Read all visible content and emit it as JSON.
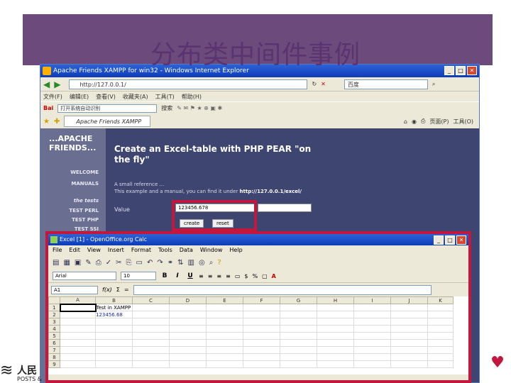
{
  "slide": {
    "title": "分布类中间件事例",
    "accent_color": "#6d4a7c",
    "highlight_color": "#c2183e"
  },
  "browser": {
    "window_title": "Apache Friends XAMPP for win32 - Windows Internet Explorer",
    "address": "http://127.0.0.1/",
    "search_text": "百度",
    "menu": [
      "文件(F)",
      "编辑(E)",
      "查看(V)",
      "收藏夹(A)",
      "工具(T)",
      "帮助(H)"
    ],
    "toolbar_combo": "打开系统自动识别",
    "toolbar_search": "搜索",
    "tab_label": "Apache Friends XAMPP for win32",
    "toolbar_right": [
      "页面(P)",
      "工具(O)"
    ]
  },
  "xampp": {
    "logo_line1": "...APACHE",
    "logo_line2": "FRIENDS...",
    "nav": [
      "WELCOME",
      "MANUALS",
      "the tests",
      "TEST PERL",
      "TEST PHP",
      "TEST SSI"
    ],
    "heading": "Create an Excel-table with PHP PEAR \"on the fly\"",
    "info_line1": "A small reference ...",
    "info_line2": "This example and a manual, you can find it under",
    "info_link": "http://127.0.0.1/excel/",
    "value_label": "Value",
    "value_input": "123456.678",
    "create_button": "create",
    "reset_button": "reset"
  },
  "spreadsheet": {
    "window_title": "Excel [1] - OpenOffice.org Calc",
    "menu": [
      "File",
      "Edit",
      "View",
      "Insert",
      "Format",
      "Tools",
      "Data",
      "Window",
      "Help"
    ],
    "font_name": "Arial",
    "font_size": "10",
    "cell_ref": "A1",
    "columns": [
      "A",
      "B",
      "C",
      "D",
      "E",
      "F",
      "G",
      "H",
      "I",
      "J",
      "K"
    ],
    "rows": [
      "1",
      "2",
      "3",
      "4",
      "5",
      "6",
      "7",
      "8",
      "9"
    ],
    "cell_b1": "Test in XAMPP",
    "cell_b2": "123456.68"
  },
  "publisher": {
    "cn": "人民",
    "en": "POSTS &"
  }
}
